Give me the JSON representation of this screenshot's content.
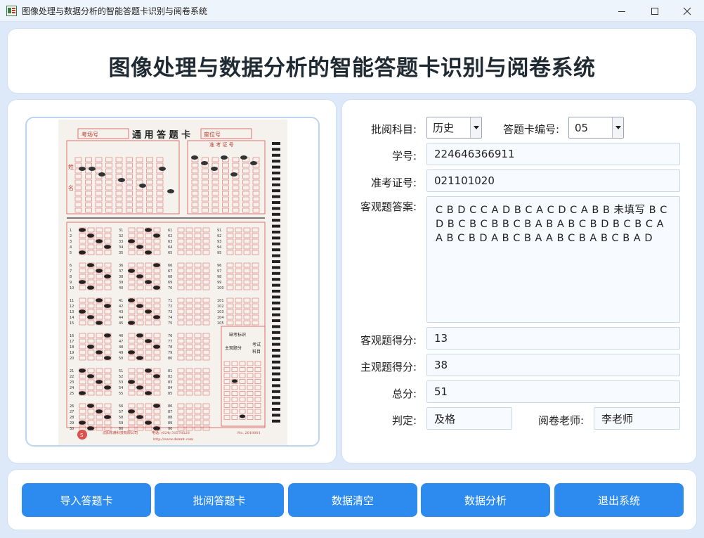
{
  "window": {
    "title": "图像处理与数据分析的智能答题卡识别与阅卷系统"
  },
  "header": {
    "title": "图像处理与数据分析的智能答题卡识别与阅卷系统"
  },
  "answer_sheet": {
    "exam_room_label": "考场号",
    "title": "通 用 答 题 卡",
    "seat_label": "座位号",
    "admission_label": "准 考 证 号",
    "name_label_1": "姓",
    "name_label_2": "名",
    "missing_exam_label": "缺考标识",
    "subjective_label": "主观题分",
    "subject_label_1": "考试",
    "subject_label_2": "科目",
    "footer_company": "沈阳东赫科技有限公司",
    "footer_phone": "电话: (024) 31578528",
    "footer_no": "No. 2018001",
    "footer_site": "http://www.dsmnt.com"
  },
  "form": {
    "subject_label": "批阅科目:",
    "subject_value": "历史",
    "card_no_label": "答题卡编号:",
    "card_no_value": "05",
    "student_id_label": "学号:",
    "student_id_value": "224646366911",
    "admission_label": "准考证号:",
    "admission_value": "021101020",
    "objective_answers_label": "客观题答案:",
    "objective_answers_value": "C B D C C A D B C A C D C A B B 未填写 B C D B C B C B B C B A B A B C B D B C B C A A B C B D A B C B A A B C B A B C B A D",
    "objective_score_label": "客观题得分:",
    "objective_score_value": "13",
    "subjective_score_label": "主观题得分:",
    "subjective_score_value": "38",
    "total_label": "总分:",
    "total_value": "51",
    "verdict_label": "判定:",
    "verdict_value": "及格",
    "teacher_label": "阅卷老师:",
    "teacher_value": "李老师"
  },
  "buttons": {
    "import": "导入答题卡",
    "grade": "批阅答题卡",
    "clear": "数据清空",
    "analyze": "数据分析",
    "exit": "退出系统"
  },
  "colors": {
    "primary": "#2d8bef",
    "background": "#dde9f8",
    "sheet_red": "#d9534f"
  }
}
